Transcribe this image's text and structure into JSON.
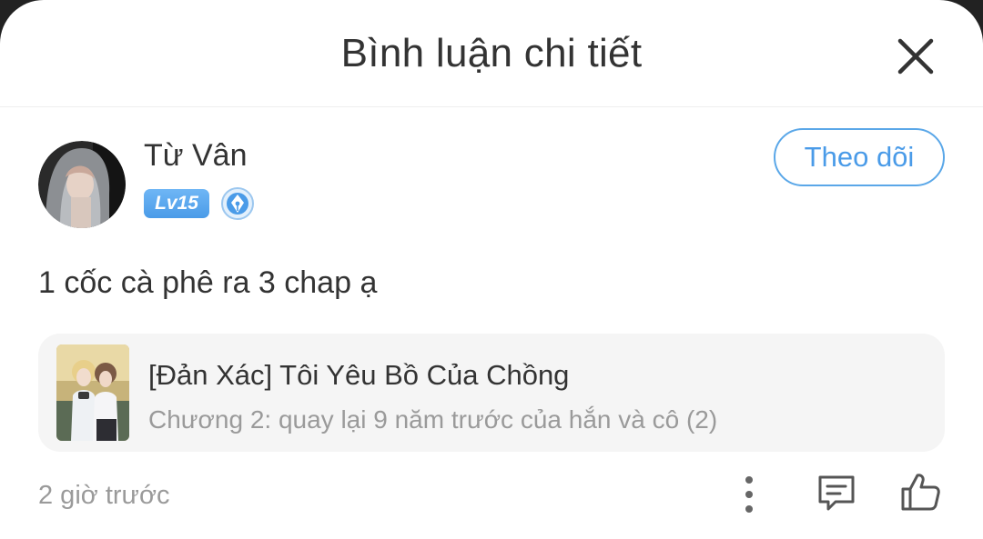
{
  "header": {
    "title": "Bình luận chi tiết",
    "close_icon": "close-icon"
  },
  "comment": {
    "avatar_icon": "user-avatar",
    "username": "Từ Vân",
    "level_badge": "Lv15",
    "author_badge_icon": "pen-nib-badge-icon",
    "follow_label": "Theo dõi",
    "text": "1 cốc cà phê ra 3 chap ạ",
    "time": "2 giờ trước"
  },
  "story": {
    "cover_icon": "story-cover-thumbnail",
    "title": "[Đản Xác] Tôi Yêu Bồ Của Chồng",
    "chapter": "Chương 2: quay lại 9 năm trước của hắn và cô (2)"
  },
  "actions": {
    "more_icon": "more-vertical-icon",
    "reply_icon": "comment-reply-icon",
    "like_icon": "thumbs-up-icon"
  },
  "colors": {
    "accent": "#4a9be8",
    "text_primary": "#333333",
    "text_secondary": "#9a9a9a",
    "card_background": "#f5f5f5"
  }
}
